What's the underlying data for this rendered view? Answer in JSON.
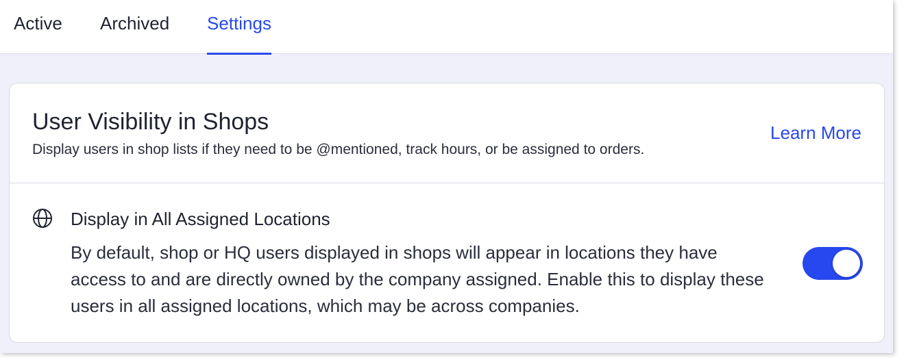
{
  "tabs": [
    {
      "label": "Active",
      "active": false
    },
    {
      "label": "Archived",
      "active": false
    },
    {
      "label": "Settings",
      "active": true
    }
  ],
  "section": {
    "title": "User Visibility in Shops",
    "subtitle": "Display users in shop lists if they need to be @mentioned, track hours, or be assigned to orders.",
    "learn_more_label": "Learn More"
  },
  "setting": {
    "icon": "globe-icon",
    "title": "Display in All Assigned Locations",
    "description": "By default, shop or HQ users displayed in shops will appear in locations they have access to and are directly owned by the company assigned. Enable this to display these users in all assigned locations, which may be across companies.",
    "enabled": true
  },
  "colors": {
    "accent": "#2748ee",
    "page_background": "#eff0f9",
    "text": "#1f2330",
    "border": "#d8dae3"
  }
}
